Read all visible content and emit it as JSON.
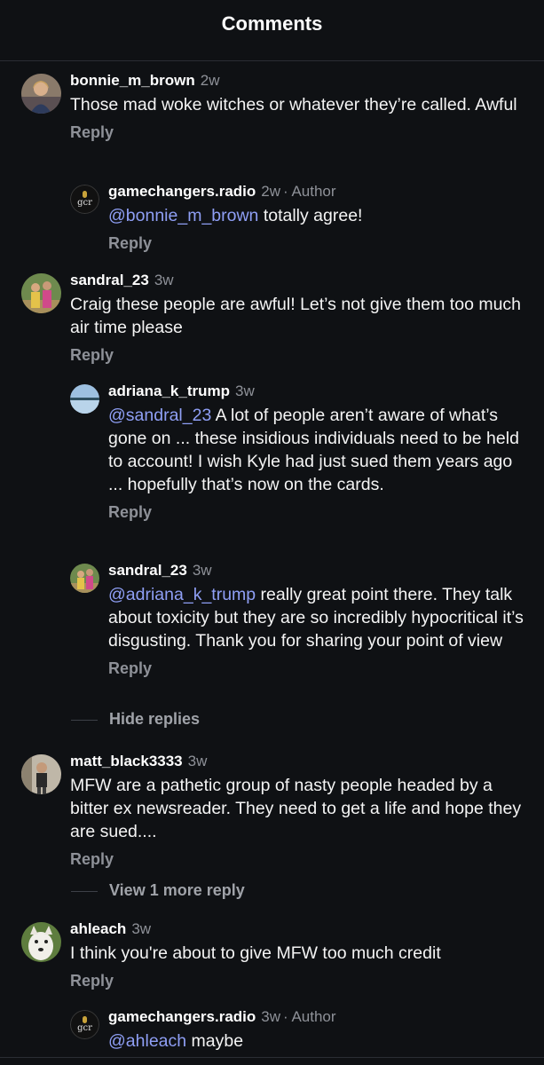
{
  "header": {
    "title": "Comments"
  },
  "comments": [
    {
      "username": "bonnie_m_brown",
      "time": "2w",
      "text": "Those mad woke witches or whatever they’re called. Awful",
      "reply_label": "Reply",
      "avatar": "user-photo"
    },
    {
      "username": "gamechangers.radio",
      "time": "2w",
      "author_tag": "· Author",
      "mention": "@bonnie_m_brown",
      "text": " totally agree!",
      "reply_label": "Reply",
      "avatar": "gcr-logo"
    },
    {
      "username": "sandral_23",
      "time": "3w",
      "text": "Craig these people are awful! Let’s not give them too much air time please",
      "reply_label": "Reply",
      "avatar": "user-photo"
    },
    {
      "username": "adriana_k_trump",
      "time": "3w",
      "mention": "@sandral_23",
      "text": " A lot of people aren’t aware of what’s gone on ... these insidious individuals need to be held to account! I wish Kyle had just sued them years ago ... hopefully that’s now on the cards.",
      "reply_label": "Reply",
      "avatar": "landscape-photo"
    },
    {
      "username": "sandral_23",
      "time": "3w",
      "mention": "@adriana_k_trump",
      "text": " really great point there. They talk about toxicity but they are so incredibly hypocritical it’s disgusting. Thank you for sharing your point of view",
      "reply_label": "Reply",
      "avatar": "user-photo"
    },
    {
      "username": "matt_black3333",
      "time": "3w",
      "text": "MFW are a pathetic group of nasty people headed by a bitter ex newsreader. They need to get a life and hope they are sued....",
      "reply_label": "Reply",
      "avatar": "user-photo"
    },
    {
      "username": "ahleach",
      "time": "3w",
      "text": "I think you're about to give MFW too much credit",
      "reply_label": "Reply",
      "avatar": "dog-photo"
    },
    {
      "username": "gamechangers.radio",
      "time": "3w",
      "author_tag": "· Author",
      "mention": "@ahleach",
      "text": " maybe",
      "avatar": "gcr-logo"
    }
  ],
  "threads": {
    "hide_replies": "Hide replies",
    "view_more": "View 1 more reply"
  },
  "logo": {
    "text": "gcr"
  },
  "colors": {
    "background": "#0f1114",
    "mention": "#8f9ff5",
    "muted": "#8e9198",
    "mic_gold": "#c9a33a"
  }
}
